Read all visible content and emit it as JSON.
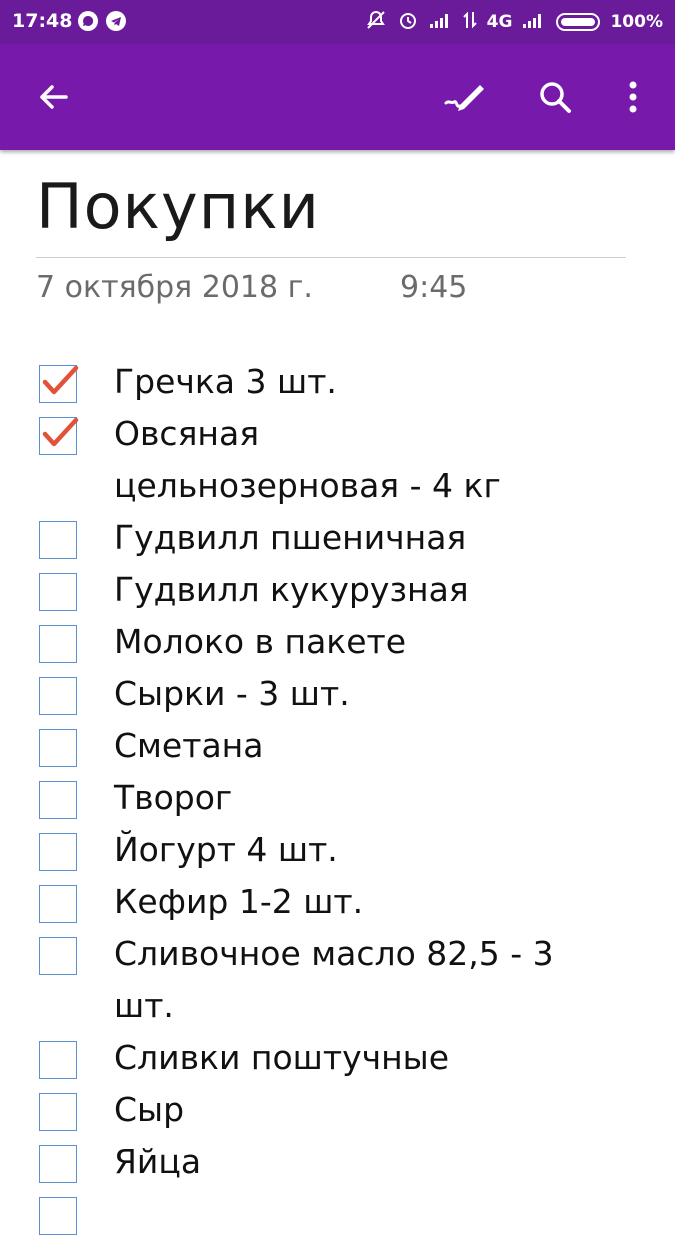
{
  "status_bar": {
    "time": "17:48",
    "network": "4G",
    "battery": "100%"
  },
  "app_bar": {
    "back_icon": "arrow-back-icon",
    "draw_icon": "pen-draw-icon",
    "search_icon": "search-icon",
    "more_icon": "more-vertical-icon"
  },
  "page": {
    "title": "Покупки",
    "date": "7 октября 2018 г.",
    "time": "9:45"
  },
  "checklist": [
    {
      "text": "Гречка 3 шт.",
      "checked": true
    },
    {
      "text": "Овсяная цельнозерновая - 4 кг",
      "checked": true
    },
    {
      "text": "Гудвилл пшеничная",
      "checked": false
    },
    {
      "text": "Гудвилл кукурузная",
      "checked": false
    },
    {
      "text": "Молоко в пакете",
      "checked": false
    },
    {
      "text": "Сырки - 3 шт.",
      "checked": false
    },
    {
      "text": "Сметана",
      "checked": false
    },
    {
      "text": "Творог",
      "checked": false
    },
    {
      "text": "Йогурт 4 шт.",
      "checked": false
    },
    {
      "text": "Кефир 1-2 шт.",
      "checked": false
    },
    {
      "text": "Сливочное масло 82,5 - 3 шт.",
      "checked": false
    },
    {
      "text": "Сливки поштучные",
      "checked": false
    },
    {
      "text": "Сыр",
      "checked": false
    },
    {
      "text": "Яйца",
      "checked": false
    },
    {
      "text": "",
      "checked": false
    }
  ],
  "colors": {
    "status_bar": "#6a1b9a",
    "app_bar": "#7719aa",
    "check_mark": "#e0533a",
    "checkbox_border": "#5b8fcf"
  }
}
